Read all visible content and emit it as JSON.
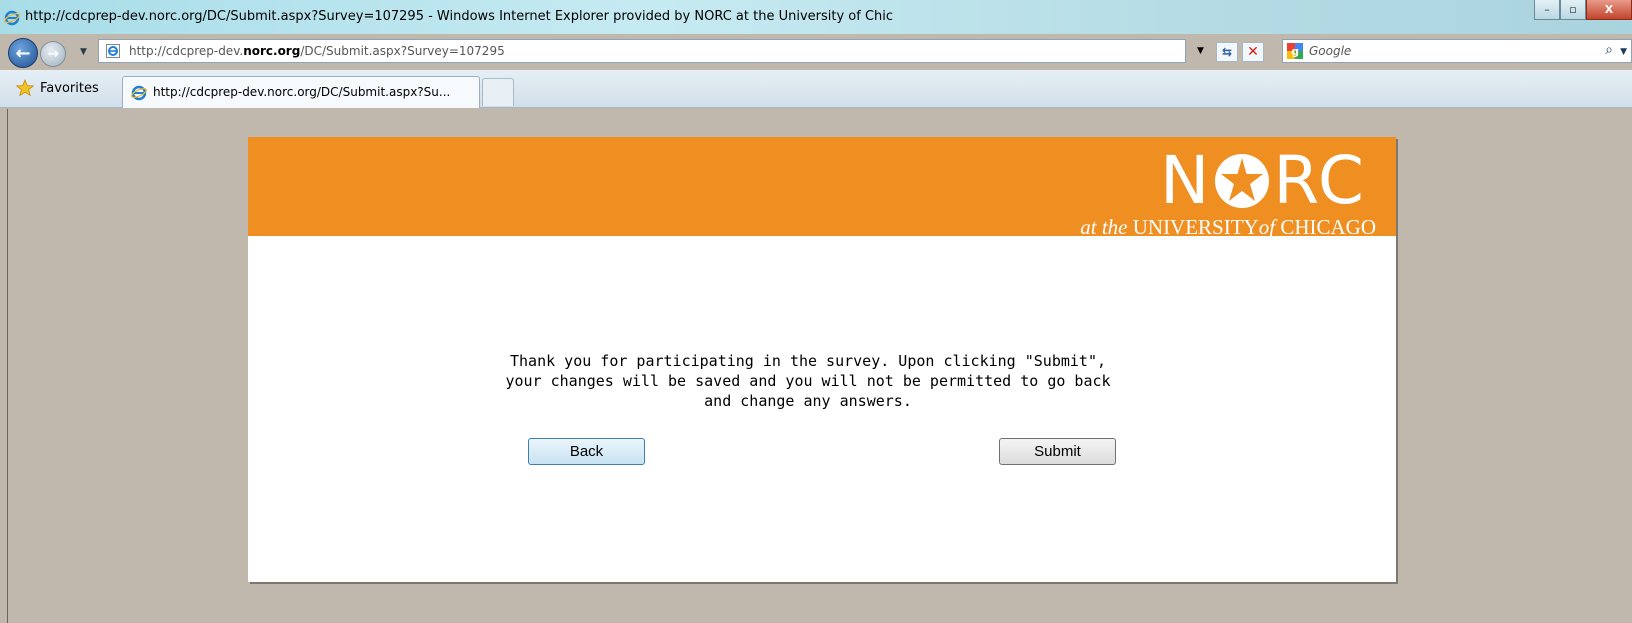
{
  "window": {
    "title": "http://cdcprep-dev.norc.org/DC/Submit.aspx?Survey=107295 - Windows Internet Explorer provided by NORC at the University of Chic",
    "buttons": {
      "minimize": "–",
      "maximize": "▫",
      "close": "X"
    }
  },
  "address_bar": {
    "url_prefix": "http://cdcprep-dev.",
    "url_domain": "norc.org",
    "url_suffix": "/DC/Submit.aspx?Survey=107295",
    "search_placeholder": "Google"
  },
  "tabs": {
    "favorites_label": "Favorites",
    "active_tab_label": "http://cdcprep-dev.norc.org/DC/Submit.aspx?Su..."
  },
  "page": {
    "logo": {
      "wordmark_left": "N",
      "wordmark_right": "RC",
      "subtitle_italic_1": "at the",
      "subtitle_1": "UNIVERSITY",
      "subtitle_italic_2": "of",
      "subtitle_2": "CHICAGO"
    },
    "message_line1": "Thank you for participating in the survey. Upon clicking \"Submit\",",
    "message_line2": "your changes will be saved and you will not be permitted to go back",
    "message_line3": "and change any answers.",
    "back_button": "Back",
    "submit_button": "Submit"
  },
  "colors": {
    "banner": "#ef8f22",
    "background": "#c0b8ac"
  },
  "icons": [
    "ie-icon",
    "back-arrow-icon",
    "forward-arrow-icon",
    "refresh-icon",
    "stop-icon",
    "google-icon",
    "search-icon",
    "favorites-star-icon"
  ]
}
